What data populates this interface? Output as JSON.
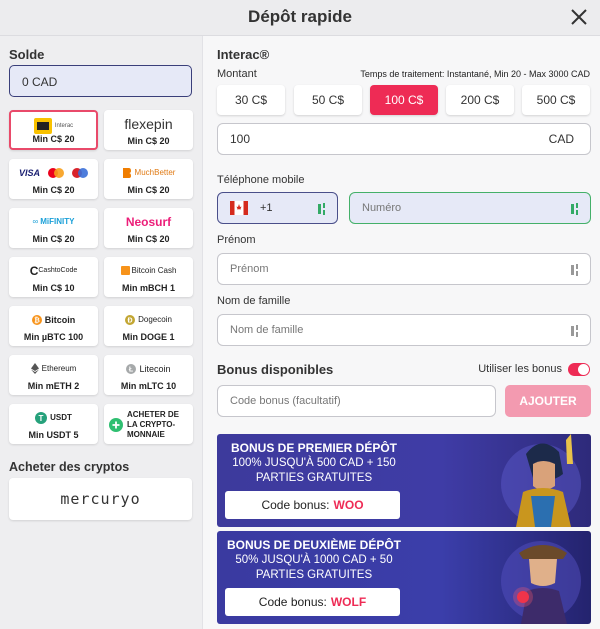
{
  "header": {
    "title": "Dépôt rapide"
  },
  "sidebar": {
    "balance_label": "Solde",
    "balance_value": "0 CAD",
    "methods": [
      {
        "logo": "Interac",
        "min": "Min C$ 20"
      },
      {
        "logo": "flexepin",
        "min": "Min C$ 20"
      },
      {
        "logo": "VISA",
        "min": "Min C$ 20"
      },
      {
        "logo": "MuchBetter",
        "min": "Min C$ 20"
      },
      {
        "logo": "MiFINITY",
        "min": "Min C$ 20"
      },
      {
        "logo": "Neosurf",
        "min": "Min C$ 20"
      },
      {
        "logo": "CashtoCode",
        "min": "Min C$ 10"
      },
      {
        "logo": "Bitcoin Cash",
        "min": "Min mBCH 1"
      },
      {
        "logo": "Bitcoin",
        "min": "Min µBTC 100"
      },
      {
        "logo": "Dogecoin",
        "min": "Min DOGE 1"
      },
      {
        "logo": "Ethereum",
        "min": "Min mETH 2"
      },
      {
        "logo": "Litecoin",
        "min": "Min mLTC 10"
      },
      {
        "logo": "USDT",
        "min": "Min USDT 5"
      }
    ],
    "buy_crypto_tile": "ACHETER DE LA CRYPTO-MONNAIE",
    "buy_label": "Acheter des cryptos",
    "mercuryo": "mercuryo"
  },
  "form": {
    "method_title": "Interac®",
    "amount_label": "Montant",
    "processing": "Temps de traitement: Instantané, Min 20 - Max 3000 CAD",
    "amounts": [
      "30 C$",
      "50 C$",
      "100 C$",
      "200 C$",
      "500 C$"
    ],
    "selected_amount": "100 C$",
    "amount_value": "100",
    "currency": "CAD",
    "phone_label": "Téléphone mobile",
    "phone_prefix": "+1",
    "phone_placeholder": "Numéro",
    "firstname_label": "Prénom",
    "firstname_placeholder": "Prénom",
    "lastname_label": "Nom de famille",
    "lastname_placeholder": "Nom de famille"
  },
  "bonus": {
    "title": "Bonus disponibles",
    "use_label": "Utiliser les bonus",
    "use_enabled": true,
    "code_placeholder": "Code bonus (facultatif)",
    "add_button": "AJOUTER",
    "banners": [
      {
        "title": "BONUS DE PREMIER DÉPÔT",
        "line1": "100% JUSQU'À 500 CAD + 150",
        "line2": "PARTIES GRATUITES",
        "code_label": "Code bonus:",
        "code": "WOO"
      },
      {
        "title": "BONUS DE DEUXIÈME DÉPÔT",
        "line1": "50% JUSQU'À 1000 CAD + 50",
        "line2": "PARTIES GRATUITES",
        "code_label": "Code bonus:",
        "code": "WOLF"
      }
    ]
  },
  "colors": {
    "accent": "#ee2b55",
    "balance_border": "#3a3f7a",
    "banner": "#3d3a9c"
  }
}
